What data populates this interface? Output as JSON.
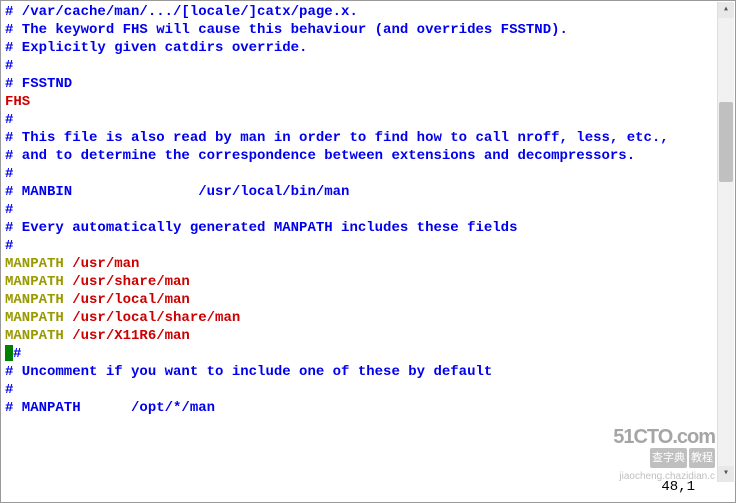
{
  "lines": [
    [
      [
        "# /var/cache/man/.../[locale/]catx/page.x.",
        "blue"
      ]
    ],
    [
      [
        "# The keyword FHS will cause this behaviour (and overrides FSSTND).",
        "blue"
      ]
    ],
    [
      [
        "# Explicitly given catdirs override.",
        "blue"
      ]
    ],
    [
      [
        "#",
        "blue"
      ]
    ],
    [
      [
        "# FSSTND",
        "blue"
      ]
    ],
    [
      [
        "FHS",
        "red"
      ]
    ],
    [
      [
        "#",
        "blue"
      ]
    ],
    [
      [
        "# This file is also read by man in order to find how to call nroff, less, etc.,",
        "blue"
      ]
    ],
    [
      [
        "# and to determine the correspondence between extensions and decompressors.",
        "blue"
      ]
    ],
    [
      [
        "#",
        "blue"
      ]
    ],
    [
      [
        "# MANBIN               /usr/local/bin/man",
        "blue"
      ]
    ],
    [
      [
        "#",
        "blue"
      ]
    ],
    [
      [
        "# Every automatically generated MANPATH includes these fields",
        "blue"
      ]
    ],
    [
      [
        "#",
        "blue"
      ]
    ],
    [
      [
        "MANPATH",
        "olive"
      ],
      [
        " /usr/man",
        "red"
      ]
    ],
    [
      [
        "MANPATH",
        "olive"
      ],
      [
        " /usr/share/man",
        "red"
      ]
    ],
    [
      [
        "MANPATH",
        "olive"
      ],
      [
        " /usr/local/man",
        "red"
      ]
    ],
    [
      [
        "MANPATH",
        "olive"
      ],
      [
        " /usr/local/share/man",
        "red"
      ]
    ],
    [
      [
        "MANPATH",
        "olive"
      ],
      [
        " /usr/X11R6/man",
        "red"
      ]
    ],
    [
      [
        "CURSOR",
        ""
      ],
      [
        "#",
        "blue"
      ]
    ],
    [
      [
        "# Uncomment if you want to include one of these by default",
        "blue"
      ]
    ],
    [
      [
        "#",
        "blue"
      ]
    ],
    [
      [
        "# MANPATH      /opt/*/man",
        "blue"
      ]
    ]
  ],
  "status": "48,1",
  "watermark": {
    "brand": "51CTO.com",
    "label1": "查字典",
    "label2": "教程",
    "url": "jiaocheng.chazidian.c"
  }
}
